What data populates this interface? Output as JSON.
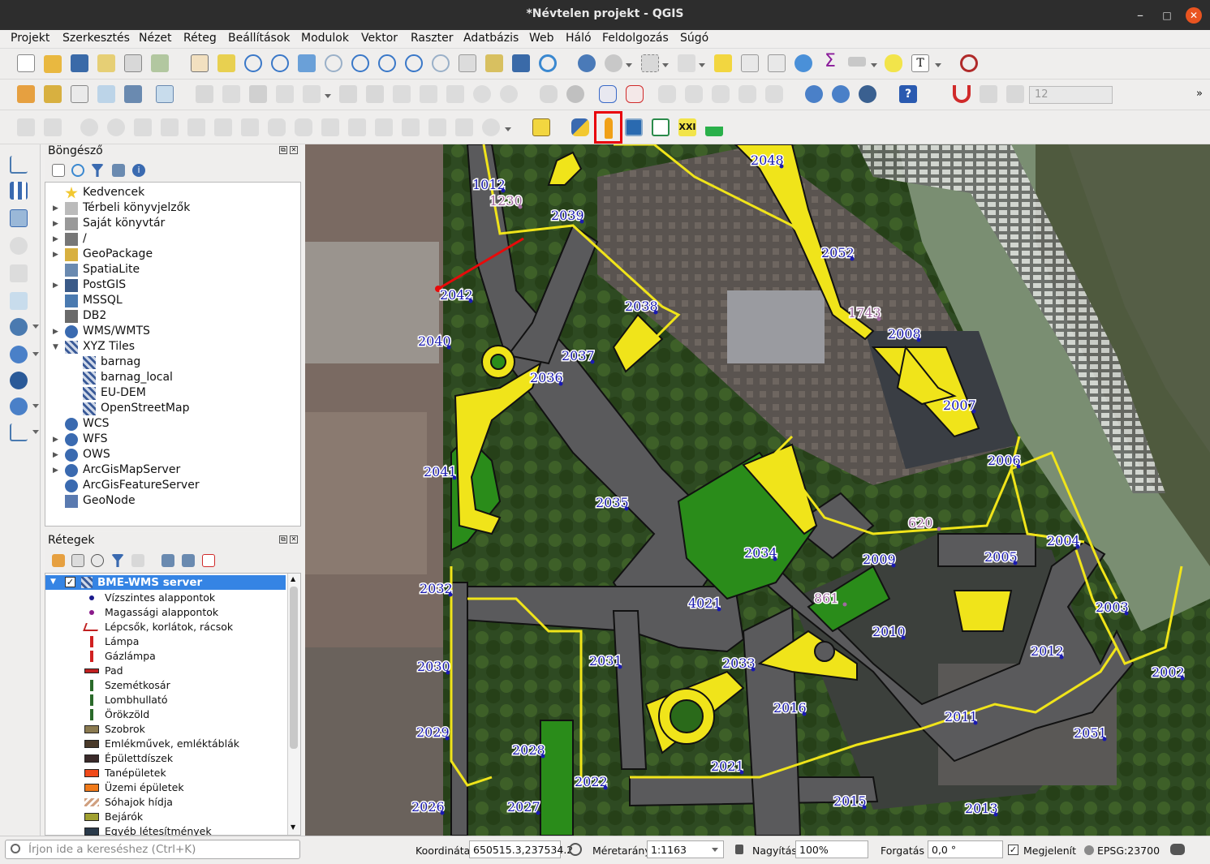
{
  "window": {
    "title": "*Névtelen projekt - QGIS"
  },
  "menu": [
    "Projekt",
    "Szerkesztés",
    "Nézet",
    "Réteg",
    "Beállítások",
    "Modulok",
    "Vektor",
    "Raszter",
    "Adatbázis",
    "Web",
    "Háló",
    "Feldolgozás",
    "Súgó"
  ],
  "toolbar": {
    "font_size_value": "12",
    "highlighted_tool_icon": "street-view-icon"
  },
  "browser": {
    "title": "Böngésző",
    "items": [
      {
        "label": "Kedvencek",
        "icon": "star-icon",
        "indent": 0,
        "arrow": ""
      },
      {
        "label": "Térbeli könyvjelzők",
        "icon": "bookmark-icon",
        "indent": 0,
        "arrow": "right"
      },
      {
        "label": "Saját könyvtár",
        "icon": "home-icon",
        "indent": 0,
        "arrow": "right"
      },
      {
        "label": "/",
        "icon": "folder-icon",
        "indent": 0,
        "arrow": "right"
      },
      {
        "label": "GeoPackage",
        "icon": "geopackage-icon",
        "indent": 0,
        "arrow": "right"
      },
      {
        "label": "SpatiaLite",
        "icon": "spatialite-icon",
        "indent": 0,
        "arrow": ""
      },
      {
        "label": "PostGIS",
        "icon": "postgis-icon",
        "indent": 0,
        "arrow": "right"
      },
      {
        "label": "MSSQL",
        "icon": "mssql-icon",
        "indent": 0,
        "arrow": ""
      },
      {
        "label": "DB2",
        "icon": "db2-icon",
        "indent": 0,
        "arrow": ""
      },
      {
        "label": "WMS/WMTS",
        "icon": "globe-icon",
        "indent": 0,
        "arrow": "right"
      },
      {
        "label": "XYZ Tiles",
        "icon": "tiles-icon",
        "indent": 0,
        "arrow": "down"
      },
      {
        "label": "barnag",
        "icon": "tiles-icon",
        "indent": 1,
        "arrow": ""
      },
      {
        "label": "barnag_local",
        "icon": "tiles-icon",
        "indent": 1,
        "arrow": ""
      },
      {
        "label": "EU-DEM",
        "icon": "tiles-icon",
        "indent": 1,
        "arrow": ""
      },
      {
        "label": "OpenStreetMap",
        "icon": "tiles-icon",
        "indent": 1,
        "arrow": ""
      },
      {
        "label": "WCS",
        "icon": "globe-icon",
        "indent": 0,
        "arrow": ""
      },
      {
        "label": "WFS",
        "icon": "wfs-icon",
        "indent": 0,
        "arrow": "right"
      },
      {
        "label": "OWS",
        "icon": "globe-icon",
        "indent": 0,
        "arrow": "right"
      },
      {
        "label": "ArcGisMapServer",
        "icon": "globe-icon",
        "indent": 0,
        "arrow": "right"
      },
      {
        "label": "ArcGisFeatureServer",
        "icon": "globe-icon",
        "indent": 0,
        "arrow": ""
      },
      {
        "label": "GeoNode",
        "icon": "geonode-icon",
        "indent": 0,
        "arrow": ""
      }
    ]
  },
  "layers": {
    "title": "Rétegek",
    "group": "BME-WMS server",
    "legend": [
      {
        "label": "Vízszintes alappontok",
        "sym": "dot",
        "color": "#1a1a8c"
      },
      {
        "label": "Magassági alappontok",
        "sym": "dot",
        "color": "#8a1a8a"
      },
      {
        "label": "Lépcsők, korlátok, rácsok",
        "sym": "stairs",
        "color": "#c02020"
      },
      {
        "label": "Lámpa",
        "sym": "lamp",
        "color": "#d02020"
      },
      {
        "label": "Gázlámpa",
        "sym": "lamp",
        "color": "#d02020"
      },
      {
        "label": "Pad",
        "sym": "bench",
        "color": "#c02020"
      },
      {
        "label": "Szemétkosár",
        "sym": "bin",
        "color": "#2a6a2a"
      },
      {
        "label": "Lombhullató",
        "sym": "tree",
        "color": "#2a6a2a"
      },
      {
        "label": "Örökzöld",
        "sym": "tree",
        "color": "#2a6a2a"
      },
      {
        "label": "Szobrok",
        "sym": "box",
        "color": "#8a7a50"
      },
      {
        "label": "Emlékművek, emléktáblák",
        "sym": "box",
        "color": "#4a3a2a"
      },
      {
        "label": "Épülettdíszek",
        "sym": "box",
        "color": "#3a2a2a"
      },
      {
        "label": "Tanépületek",
        "sym": "box",
        "color": "#f04a1a"
      },
      {
        "label": "Üzemi épületek",
        "sym": "box",
        "color": "#f07a1a"
      },
      {
        "label": "Sóhajok hídja",
        "sym": "hatch",
        "color": "#d0a080"
      },
      {
        "label": "Bejárók",
        "sym": "box",
        "color": "#a0a030"
      },
      {
        "label": "Egyéb létesítmények",
        "sym": "box",
        "color": "#2a3a4a"
      }
    ]
  },
  "map_labels": {
    "blue": [
      "1012",
      "2039",
      "2042",
      "2038",
      "2040",
      "2037",
      "2036",
      "2041",
      "2035",
      "2034",
      "4021",
      "2032",
      "2031",
      "2033",
      "2030",
      "2029",
      "2028",
      "2016",
      "2021",
      "2022",
      "2027",
      "2026",
      "2048",
      "2052",
      "2008",
      "2007",
      "2006",
      "2009",
      "2005",
      "2004",
      "2010",
      "2003",
      "2012",
      "2002",
      "2011",
      "2051",
      "2015",
      "2013"
    ],
    "purple": [
      "1230",
      "1743",
      "620",
      "861"
    ]
  },
  "search": {
    "placeholder": "Írjon ide a kereséshez (Ctrl+K)"
  },
  "status": {
    "coord_label": "Koordináta",
    "coord_value": "650515.3,237534.2",
    "scale_label": "Méretarány",
    "scale_value": "1:1163",
    "zoom_label": "Nagyítás",
    "zoom_value": "100%",
    "rotation_label": "Forgatás",
    "rotation_value": "0,0 °",
    "render_label": "Megjelenít",
    "crs": "EPSG:23700"
  }
}
